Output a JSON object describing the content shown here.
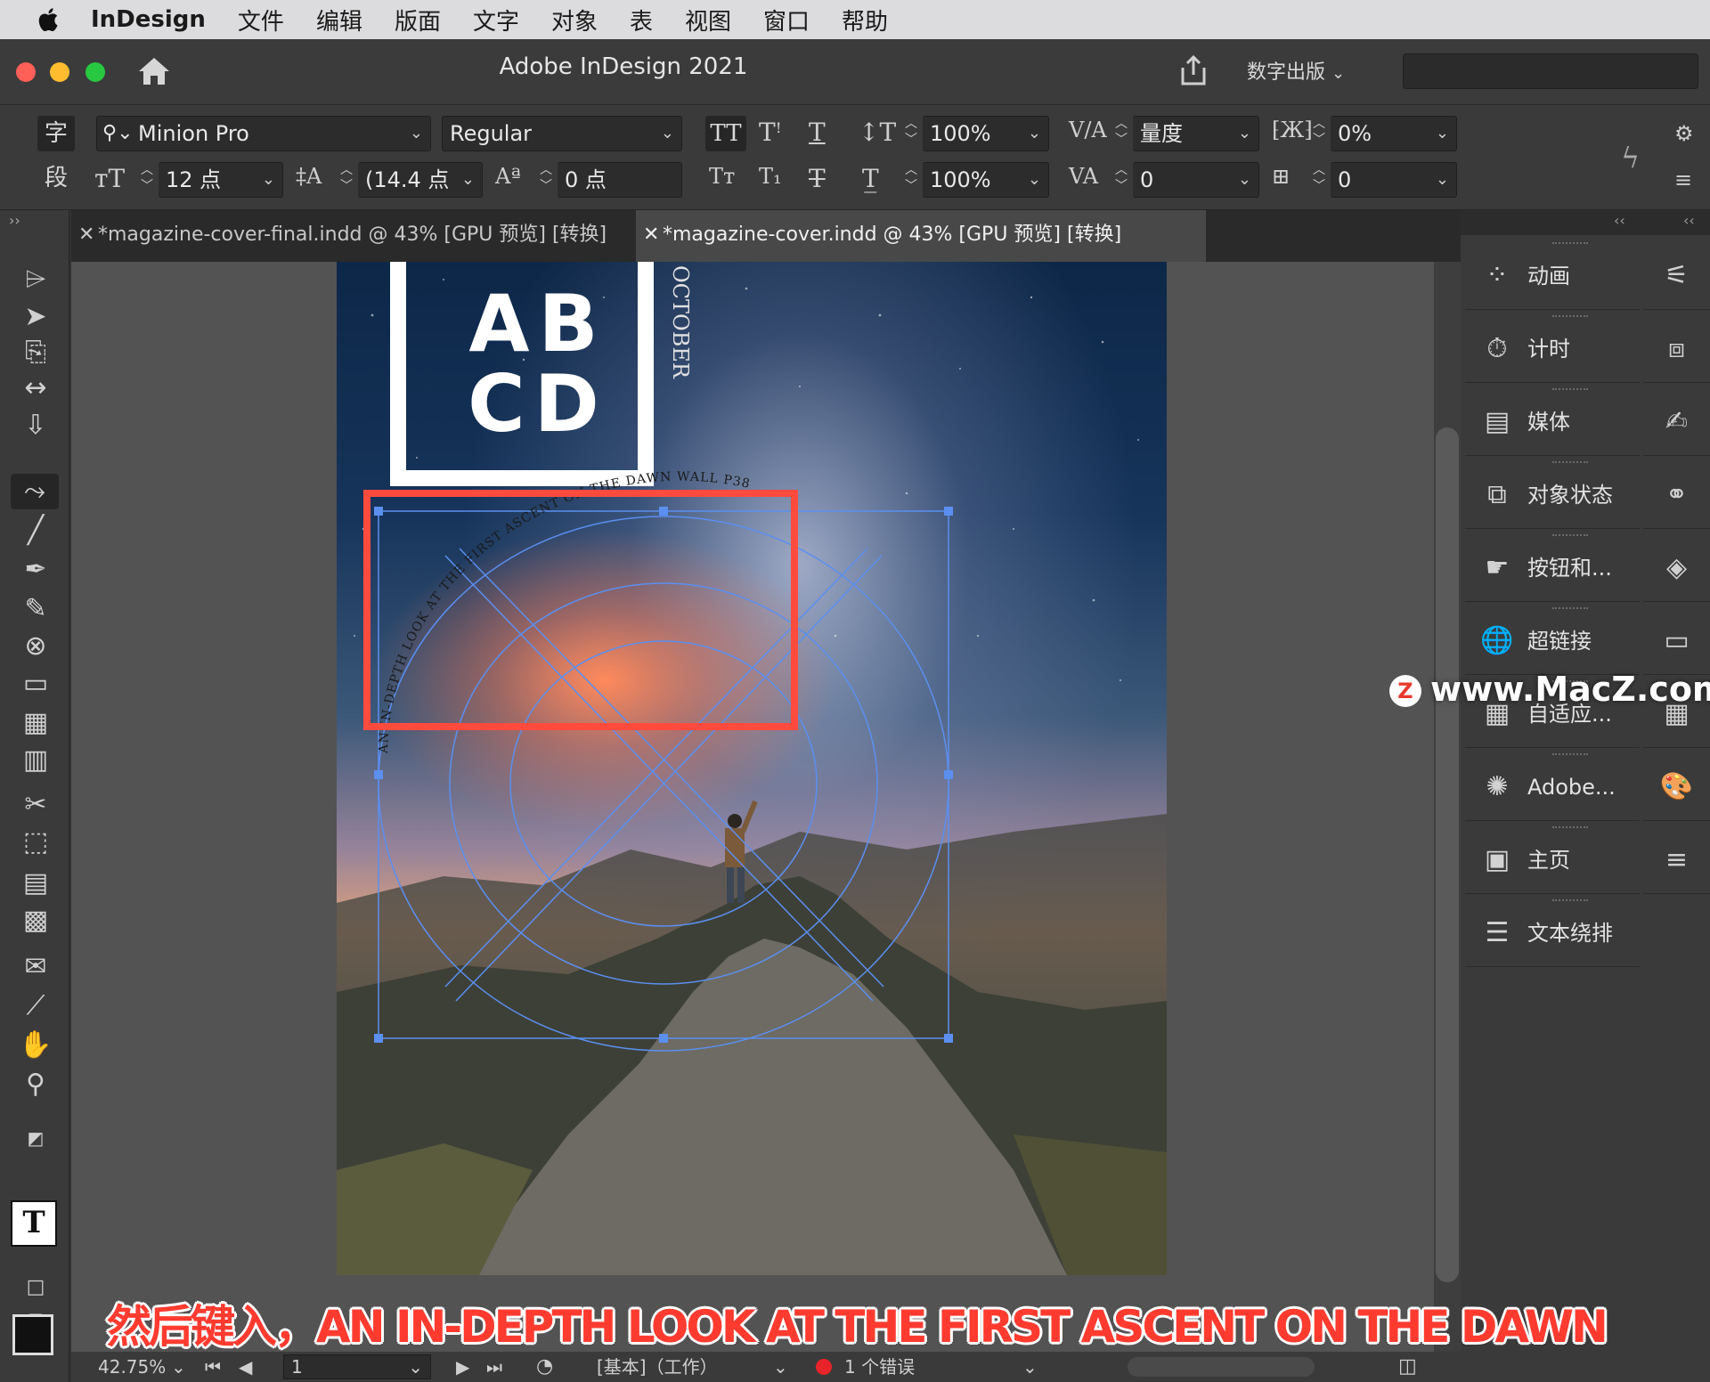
{
  "menubar": {
    "app": "InDesign",
    "items": [
      "文件",
      "编辑",
      "版面",
      "文字",
      "对象",
      "表",
      "视图",
      "窗口",
      "帮助"
    ]
  },
  "window": {
    "title": "Adobe InDesign 2021",
    "workspace": "数字出版"
  },
  "control": {
    "char_tab": "字",
    "para_tab": "段",
    "font_family": "Minion Pro",
    "font_style": "Regular",
    "font_size": "12 点",
    "leading": "(14.4 点",
    "baseline_shift": "0 点",
    "vertical_scale": "100%",
    "horizontal_scale": "100%",
    "kerning": "量度",
    "tracking": "0",
    "tsume": "0%",
    "grid_count": "0"
  },
  "tabs": [
    {
      "label": "*magazine-cover-final.indd @ 43% [GPU 预览] [转换]",
      "active": false
    },
    {
      "label": "*magazine-cover.indd @ 43% [GPU 预览] [转换]",
      "active": true
    }
  ],
  "document": {
    "logo_line1": "AB",
    "logo_line2": "CD",
    "month": "OCTOBER",
    "path_text": "AN IN-DEPTH LOOK AT THE FIRST ASCENT ON THE DAWN WALL P38"
  },
  "panels": [
    {
      "label": "动画",
      "icon": "animation-icon"
    },
    {
      "label": "计时",
      "icon": "timing-icon"
    },
    {
      "label": "媒体",
      "icon": "media-icon"
    },
    {
      "label": "对象状态",
      "icon": "object-states-icon"
    },
    {
      "label": "按钮和...",
      "icon": "buttons-icon"
    },
    {
      "label": "超链接",
      "icon": "hyperlinks-icon"
    },
    {
      "label": "自适应...",
      "icon": "liquid-layout-icon"
    },
    {
      "label": "Adobe...",
      "icon": "adobe-color-icon"
    },
    {
      "label": "主页",
      "icon": "pages-icon"
    },
    {
      "label": "文本绕排",
      "icon": "text-wrap-icon"
    }
  ],
  "status": {
    "zoom": "42.75%",
    "page": "1",
    "profile": "[基本]（工作）",
    "errors": "1 个错误"
  },
  "subtitle": "然后键入，AN IN-DEPTH LOOK AT THE FIRST ASCENT ON THE DAWN",
  "watermark": "www.MacZ.com",
  "colors": {
    "selection": "#5b8ff0",
    "highlight": "#ff4b3e",
    "subtitle": "#ff3b30"
  }
}
